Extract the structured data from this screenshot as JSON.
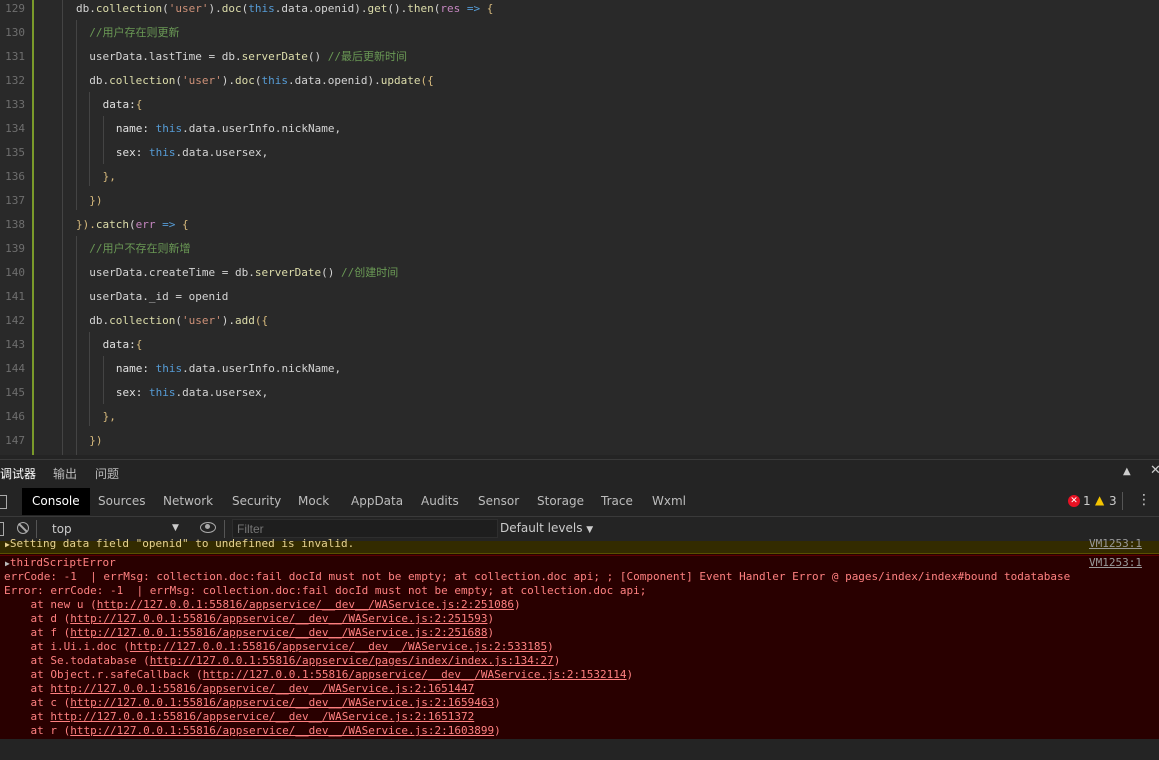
{
  "editor": {
    "lines": [
      {
        "n": "129",
        "indent": 1,
        "tokens": [
          [
            "id",
            "db."
          ],
          [
            "fn",
            "collection"
          ],
          [
            "ar",
            "("
          ],
          [
            "str",
            "'user'"
          ],
          [
            "ar",
            ")."
          ],
          [
            "fn",
            "doc"
          ],
          [
            "ar",
            "("
          ],
          [
            "kw",
            "this"
          ],
          [
            "id",
            ".data.openid)."
          ],
          [
            "fn",
            "get"
          ],
          [
            "ar",
            "()."
          ],
          [
            "fn",
            "then"
          ],
          [
            "ar",
            "("
          ],
          [
            "pa",
            "res"
          ],
          [
            "kw",
            " =>"
          ],
          [
            "br",
            " {"
          ]
        ]
      },
      {
        "n": "130",
        "indent": 2,
        "tokens": [
          [
            "cm",
            "//用户存在则更新"
          ]
        ]
      },
      {
        "n": "131",
        "indent": 2,
        "tokens": [
          [
            "id",
            "userData.lastTime = db."
          ],
          [
            "fn",
            "serverDate"
          ],
          [
            "ar",
            "() "
          ],
          [
            "cm",
            "//最后更新时间"
          ]
        ]
      },
      {
        "n": "132",
        "indent": 2,
        "tokens": [
          [
            "id",
            "db."
          ],
          [
            "fn",
            "collection"
          ],
          [
            "ar",
            "("
          ],
          [
            "str",
            "'user'"
          ],
          [
            "ar",
            ")."
          ],
          [
            "fn",
            "doc"
          ],
          [
            "ar",
            "("
          ],
          [
            "kw",
            "this"
          ],
          [
            "id",
            ".data.openid)."
          ],
          [
            "fn",
            "update"
          ],
          [
            "br",
            "({"
          ]
        ]
      },
      {
        "n": "133",
        "indent": 3,
        "tokens": [
          [
            "key",
            "data:"
          ],
          [
            "br",
            "{"
          ]
        ]
      },
      {
        "n": "134",
        "indent": 4,
        "tokens": [
          [
            "key",
            "name: "
          ],
          [
            "kw",
            "this"
          ],
          [
            "id",
            ".data.userInfo.nickName,"
          ]
        ]
      },
      {
        "n": "135",
        "indent": 4,
        "tokens": [
          [
            "key",
            "sex: "
          ],
          [
            "kw",
            "this"
          ],
          [
            "id",
            ".data.usersex,"
          ]
        ]
      },
      {
        "n": "136",
        "indent": 3,
        "tokens": [
          [
            "br",
            "},"
          ]
        ]
      },
      {
        "n": "137",
        "indent": 2,
        "tokens": [
          [
            "br",
            "})"
          ]
        ]
      },
      {
        "n": "138",
        "indent": 1,
        "tokens": [
          [
            "br",
            "})."
          ],
          [
            "fn",
            "catch"
          ],
          [
            "ar",
            "("
          ],
          [
            "pa",
            "err"
          ],
          [
            "kw",
            " =>"
          ],
          [
            "br",
            " {"
          ]
        ]
      },
      {
        "n": "139",
        "indent": 2,
        "tokens": [
          [
            "cm",
            "//用户不存在则新增"
          ]
        ]
      },
      {
        "n": "140",
        "indent": 2,
        "tokens": [
          [
            "id",
            "userData.createTime = db."
          ],
          [
            "fn",
            "serverDate"
          ],
          [
            "ar",
            "() "
          ],
          [
            "cm",
            "//创建时间"
          ]
        ]
      },
      {
        "n": "141",
        "indent": 2,
        "tokens": [
          [
            "id",
            "userData._id = openid"
          ]
        ]
      },
      {
        "n": "142",
        "indent": 2,
        "tokens": [
          [
            "id",
            "db."
          ],
          [
            "fn",
            "collection"
          ],
          [
            "ar",
            "("
          ],
          [
            "str",
            "'user'"
          ],
          [
            "ar",
            ")."
          ],
          [
            "fn",
            "add"
          ],
          [
            "br",
            "({"
          ]
        ]
      },
      {
        "n": "143",
        "indent": 3,
        "tokens": [
          [
            "key",
            "data:"
          ],
          [
            "br",
            "{"
          ]
        ]
      },
      {
        "n": "144",
        "indent": 4,
        "tokens": [
          [
            "key",
            "name: "
          ],
          [
            "kw",
            "this"
          ],
          [
            "id",
            ".data.userInfo.nickName,"
          ]
        ]
      },
      {
        "n": "145",
        "indent": 4,
        "tokens": [
          [
            "key",
            "sex: "
          ],
          [
            "kw",
            "this"
          ],
          [
            "id",
            ".data.usersex,"
          ]
        ]
      },
      {
        "n": "146",
        "indent": 3,
        "tokens": [
          [
            "br",
            "},"
          ]
        ]
      },
      {
        "n": "147",
        "indent": 2,
        "tokens": [
          [
            "br",
            "})"
          ]
        ]
      }
    ]
  },
  "panel": {
    "tabs": [
      "调试器",
      "输出",
      "问题"
    ],
    "collapse_icon": "chevron-up-icon",
    "close_icon": "close-icon"
  },
  "devtools": {
    "tabs": [
      "Console",
      "Sources",
      "Network",
      "Security",
      "Mock",
      "AppData",
      "Audits",
      "Sensor",
      "Storage",
      "Trace",
      "Wxml"
    ],
    "error_count": "1",
    "warning_count": "3",
    "error_color": "#e81123",
    "warning_color": "#f4c400"
  },
  "filter": {
    "context": "top",
    "placeholder": "Filter",
    "levels": "Default levels"
  },
  "console": {
    "warning_text": "Setting data field \"openid\" to undefined is invalid.",
    "warning_source": "VM1253:1",
    "error_group": "thirdScriptError",
    "error_source": "VM1253:1",
    "line1": "errCode: -1  | errMsg: collection.doc:fail docId must not be empty; at collection.doc api; ; [Component] Event Handler Error @ pages/index/index#bound todatabase",
    "line2": "Error: errCode: -1  | errMsg: collection.doc:fail docId must not be empty; at collection.doc api;",
    "stack": [
      {
        "prefix": "    at new u (",
        "url": "http://127.0.0.1:55816/appservice/__dev__/WAService.js:2:251086",
        "suffix": ")"
      },
      {
        "prefix": "    at d (",
        "url": "http://127.0.0.1:55816/appservice/__dev__/WAService.js:2:251593",
        "suffix": ")"
      },
      {
        "prefix": "    at f (",
        "url": "http://127.0.0.1:55816/appservice/__dev__/WAService.js:2:251688",
        "suffix": ")"
      },
      {
        "prefix": "    at i.Ui.i.doc (",
        "url": "http://127.0.0.1:55816/appservice/__dev__/WAService.js:2:533185",
        "suffix": ")"
      },
      {
        "prefix": "    at Se.todatabase (",
        "url": "http://127.0.0.1:55816/appservice/pages/index/index.js:134:27",
        "suffix": ")"
      },
      {
        "prefix": "    at Object.r.safeCallback (",
        "url": "http://127.0.0.1:55816/appservice/__dev__/WAService.js:2:1532114",
        "suffix": ")"
      },
      {
        "prefix": "    at ",
        "url": "http://127.0.0.1:55816/appservice/__dev__/WAService.js:2:1651447",
        "suffix": ""
      },
      {
        "prefix": "    at c (",
        "url": "http://127.0.0.1:55816/appservice/__dev__/WAService.js:2:1659463",
        "suffix": ")"
      },
      {
        "prefix": "    at ",
        "url": "http://127.0.0.1:55816/appservice/__dev__/WAService.js:2:1651372",
        "suffix": ""
      },
      {
        "prefix": "    at r (",
        "url": "http://127.0.0.1:55816/appservice/__dev__/WAService.js:2:1603899",
        "suffix": ")"
      }
    ]
  }
}
